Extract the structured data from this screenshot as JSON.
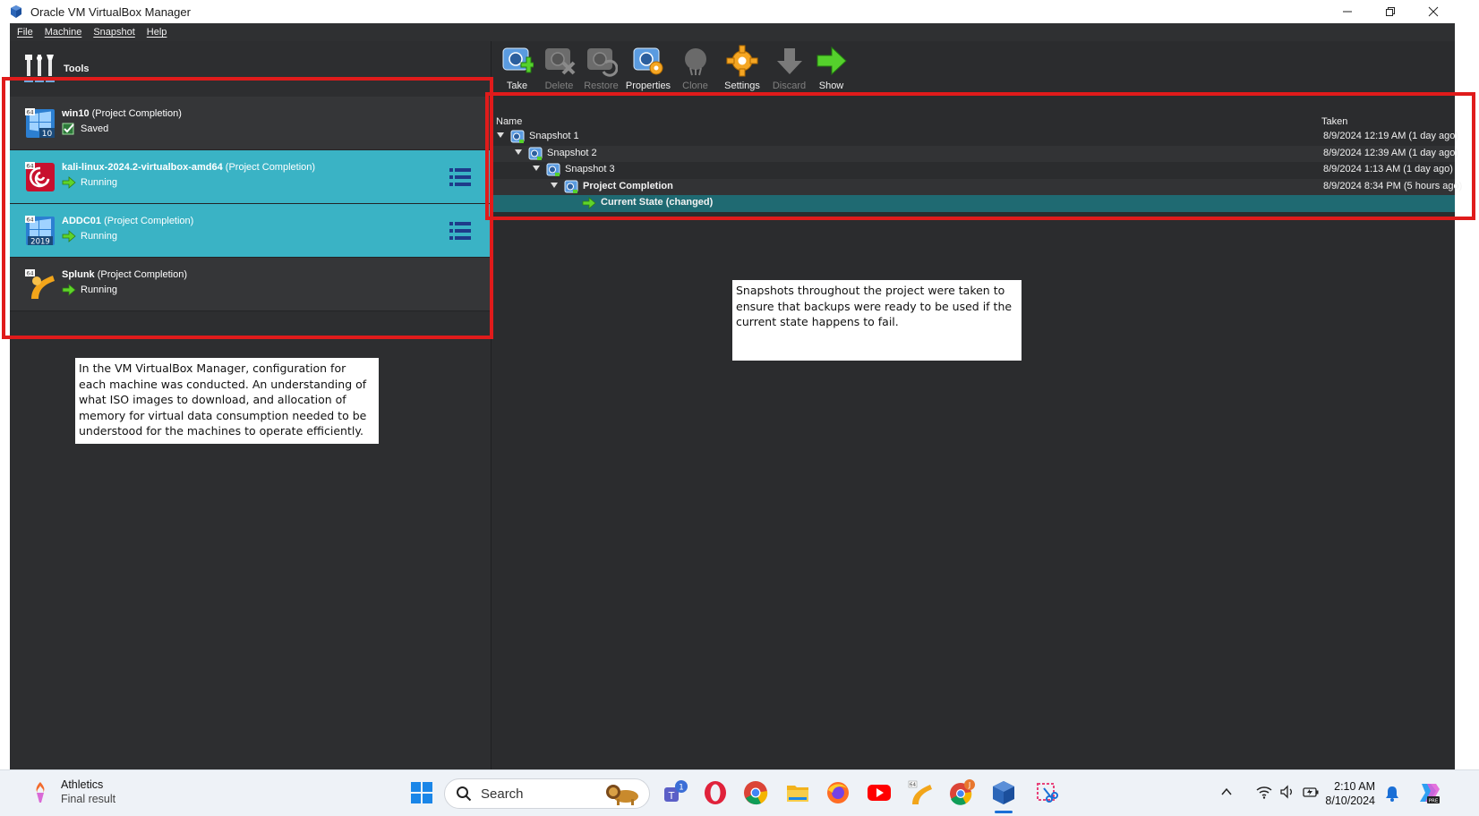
{
  "window": {
    "title": "Oracle VM VirtualBox Manager",
    "controls": [
      "minimize-icon",
      "restore-icon",
      "close-icon"
    ]
  },
  "menubar": {
    "items": [
      "File",
      "Machine",
      "Snapshot",
      "Help"
    ]
  },
  "left_pane": {
    "tools_label": "Tools",
    "vms": [
      {
        "name": "win10",
        "group": " (Project Completion)",
        "state": "Saved",
        "os_badge": "10",
        "icon": "windows-10-icon",
        "selected": false
      },
      {
        "name": "kali-linux-2024.2-virtualbox-amd64",
        "group": " (Project Completion)",
        "state": "Running",
        "icon": "debian-swirl-icon",
        "selected": true
      },
      {
        "name": "ADDC01",
        "group": " (Project Completion)",
        "state": "Running",
        "os_badge": "2019",
        "icon": "windows-server-2019-icon",
        "selected": true
      },
      {
        "name": "Splunk",
        "group": " (Project Completion)",
        "state": "Running",
        "icon": "linux-generic-icon",
        "selected": false
      }
    ]
  },
  "toolbar": {
    "buttons": [
      {
        "label": "Take",
        "enabled": true,
        "icon": "take-snapshot-icon"
      },
      {
        "label": "Delete",
        "enabled": false,
        "icon": "delete-snapshot-icon"
      },
      {
        "label": "Restore",
        "enabled": false,
        "icon": "restore-snapshot-icon"
      },
      {
        "label": "Properties",
        "enabled": true,
        "icon": "snapshot-properties-icon"
      },
      {
        "label": "Clone",
        "enabled": false,
        "icon": "clone-icon"
      },
      {
        "label": "Settings",
        "enabled": true,
        "icon": "settings-gear-icon"
      },
      {
        "label": "Discard",
        "enabled": false,
        "icon": "discard-icon"
      },
      {
        "label": "Show",
        "enabled": true,
        "icon": "show-arrow-icon"
      }
    ]
  },
  "snapshots": {
    "columns": {
      "name": "Name",
      "taken": "Taken"
    },
    "rows": [
      {
        "name": "Snapshot 1",
        "taken": "8/9/2024 12:19 AM (1 day ago)",
        "depth": 0,
        "bold": false
      },
      {
        "name": "Snapshot 2",
        "taken": "8/9/2024 12:39 AM (1 day ago)",
        "depth": 1,
        "bold": false
      },
      {
        "name": "Snapshot 3",
        "taken": "8/9/2024 1:13 AM (1 day ago)",
        "depth": 2,
        "bold": false
      },
      {
        "name": "Project Completion",
        "taken": "8/9/2024 8:34 PM (5 hours ago)",
        "depth": 3,
        "bold": true
      },
      {
        "name": "Current State (changed)",
        "taken": "",
        "depth": 4,
        "bold": true,
        "current": true
      }
    ]
  },
  "annotations": {
    "left": "In the VM VirtualBox Manager, configuration for each machine was conducted. An understanding of what ISO images to download, and allocation of memory for virtual data consumption needed to be understood for the machines to operate efficiently.",
    "right": "Snapshots throughout the project were taken to ensure that backups were ready to be used if the current state happens to fail."
  },
  "taskbar": {
    "weather_title": "Athletics",
    "weather_sub": "Final result",
    "search_placeholder": "Search",
    "teams_badge": "1",
    "chrome_badge": "J",
    "time": "2:10 AM",
    "date": "8/10/2024",
    "apps": [
      "windows-start-icon",
      "teams-icon",
      "opera-icon",
      "chrome-icon",
      "file-explorer-icon",
      "firefox-icon",
      "youtube-icon",
      "app-icon",
      "chrome-profile-icon",
      "virtualbox-icon",
      "snipping-tool-icon"
    ]
  },
  "colors": {
    "app_bg": "#2b2c2e",
    "selected_row": "#3ab3c5",
    "current_state_row": "#1f6a72",
    "highlight_box": "#e01b1b"
  }
}
